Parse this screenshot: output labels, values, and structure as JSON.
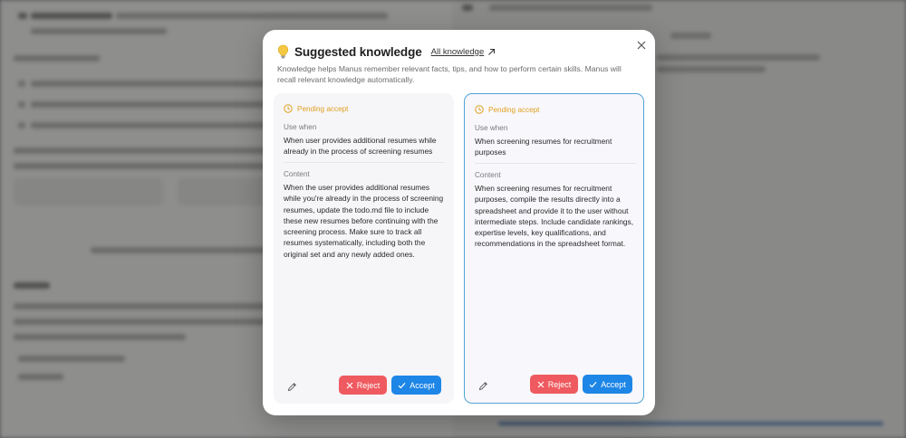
{
  "modal": {
    "title": "Suggested knowledge",
    "all_link": "All knowledge",
    "description": "Knowledge helps Manus remember relevant facts, tips, and how to perform certain skills. Manus will recall relevant knowledge automatically."
  },
  "cards": [
    {
      "status": "Pending accept",
      "use_when_label": "Use when",
      "use_when": "When user provides additional resumes while already in the process of screening resumes",
      "content_label": "Content",
      "content": "When the user provides additional resumes while you're already in the process of screening resumes, update the todo.md file to include these new resumes before continuing with the screening process. Make sure to track all resumes systematically, including both the original set and any newly added ones.",
      "reject_label": "Reject",
      "accept_label": "Accept"
    },
    {
      "status": "Pending accept",
      "use_when_label": "Use when",
      "use_when": "When screening resumes for recruitment purposes",
      "content_label": "Content",
      "content": "When screening resumes for recruitment purposes, compile the results directly into a spreadsheet and provide it to the user without intermediate steps. Include candidate rankings, expertise levels, key qualifications, and recommendations in the spreadsheet format.",
      "reject_label": "Reject",
      "accept_label": "Accept"
    }
  ],
  "colors": {
    "pending": "#e0a122",
    "reject": "#ee5a5f",
    "accept": "#1e86e6",
    "selected_border": "#4fa3d8"
  },
  "icons": {
    "title": "lightbulb-icon",
    "link": "arrow-up-right-icon",
    "close": "close-icon",
    "status": "clock-icon",
    "edit": "pencil-icon",
    "reject": "x-icon",
    "accept": "check-icon"
  }
}
